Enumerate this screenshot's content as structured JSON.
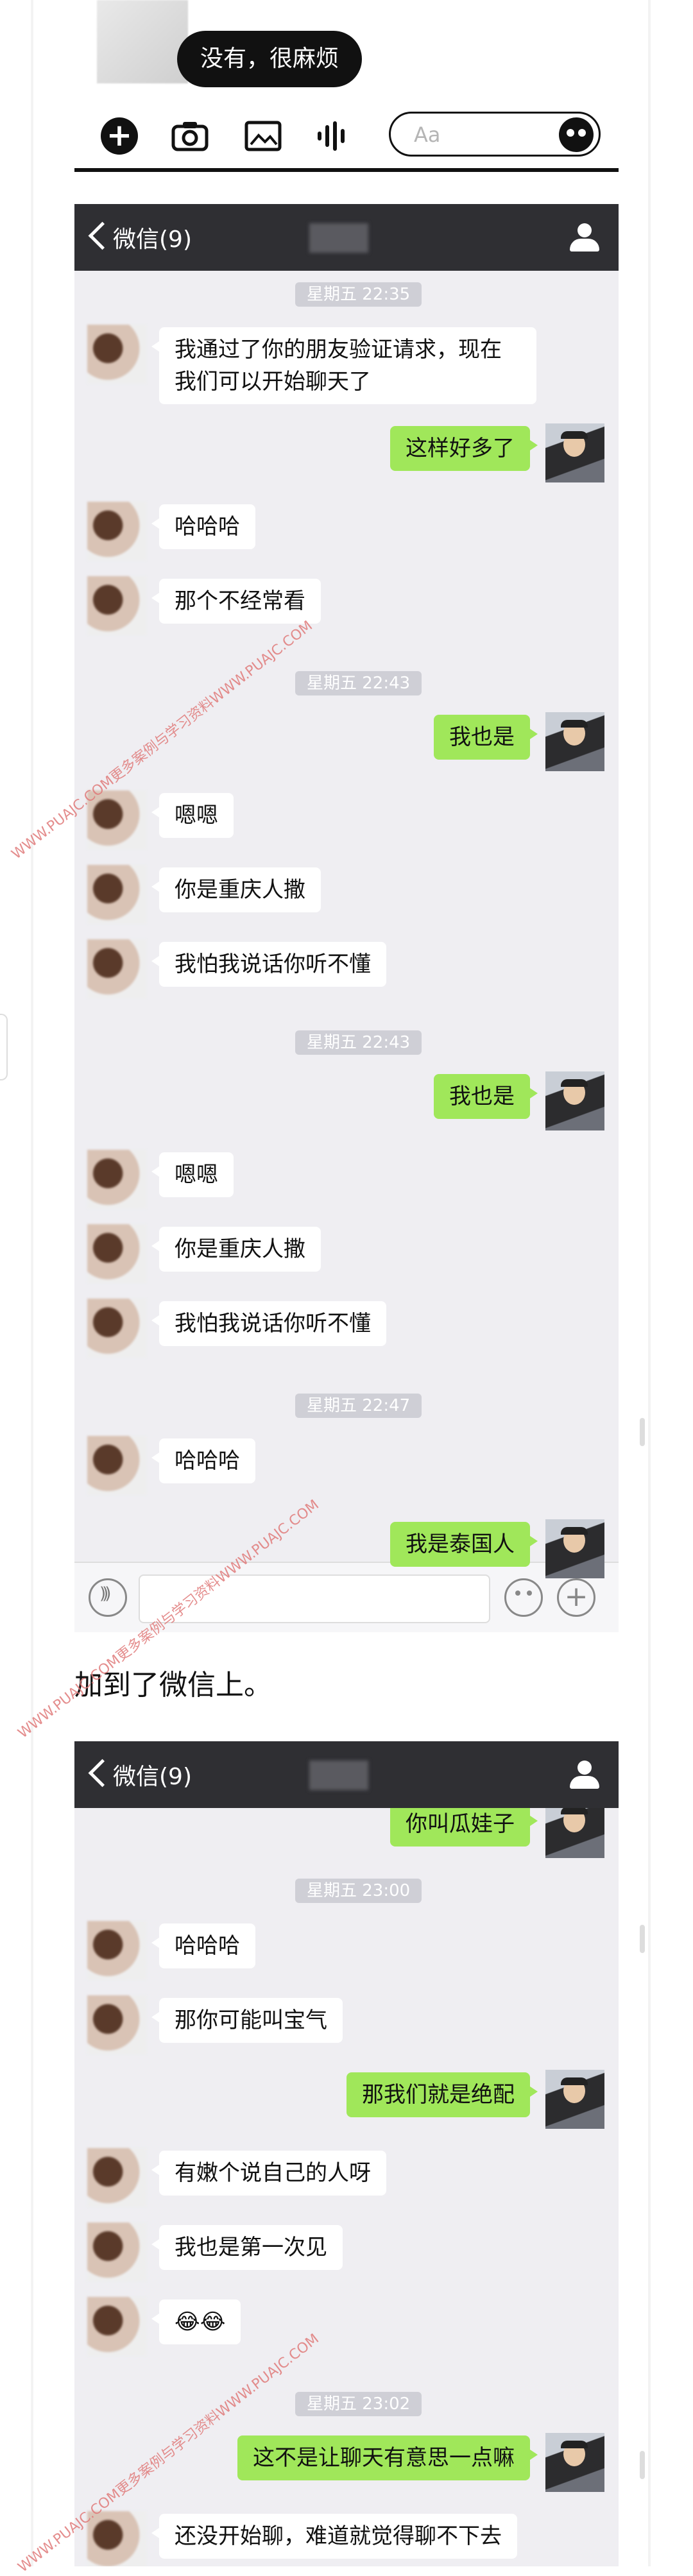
{
  "top_strip": {
    "bubble_text": "没有，很麻烦",
    "input_placeholder": "Aa"
  },
  "panels": [
    {
      "header_title": "微信(9)",
      "items": [
        {
          "kind": "ts",
          "text": "星期五 22:35"
        },
        {
          "kind": "in",
          "text": "我通过了你的朋友验证请求，现在我们可以开始聊天了",
          "multi": true
        },
        {
          "kind": "out",
          "text": "这样好多了"
        },
        {
          "kind": "in",
          "text": "哈哈哈"
        },
        {
          "kind": "in",
          "text": "那个不经常看"
        },
        {
          "kind": "ts",
          "text": "星期五 22:43"
        },
        {
          "kind": "out",
          "text": "我也是"
        },
        {
          "kind": "in",
          "text": "嗯嗯"
        },
        {
          "kind": "in",
          "text": "你是重庆人撒"
        },
        {
          "kind": "in",
          "text": "我怕我说话你听不懂"
        },
        {
          "kind": "ts",
          "text": "星期五 22:43"
        },
        {
          "kind": "out",
          "text": "我也是"
        },
        {
          "kind": "in",
          "text": "嗯嗯"
        },
        {
          "kind": "in",
          "text": "你是重庆人撒"
        },
        {
          "kind": "in",
          "text": "我怕我说话你听不懂"
        },
        {
          "kind": "ts",
          "text": "星期五 22:47"
        },
        {
          "kind": "in",
          "text": "哈哈哈"
        },
        {
          "kind": "out",
          "text": "我是泰国人"
        }
      ]
    },
    {
      "header_title": "微信(9)",
      "items": [
        {
          "kind": "out",
          "text": "你叫瓜娃子"
        },
        {
          "kind": "ts",
          "text": "星期五 23:00"
        },
        {
          "kind": "in",
          "text": "哈哈哈"
        },
        {
          "kind": "in",
          "text": "那你可能叫宝气"
        },
        {
          "kind": "out",
          "text": "那我们就是绝配"
        },
        {
          "kind": "in",
          "text": "有嫩个说自己的人呀"
        },
        {
          "kind": "in",
          "text": "我也是第一次见"
        },
        {
          "kind": "in",
          "text": "😂😂"
        },
        {
          "kind": "ts",
          "text": "星期五 23:02"
        },
        {
          "kind": "out",
          "text": "这不是让聊天有意思一点嘛"
        },
        {
          "kind": "in",
          "text": "还没开始聊，难道就觉得聊不下去"
        }
      ]
    }
  ],
  "middle_text": "加到了微信上。",
  "watermark_text": "WWW.PUAJC.COM更多案例与学习资料WWW.PUAJC.COM",
  "colors": {
    "header_bg": "#2f2f33",
    "chat_bg": "#efeef2",
    "out_bubble": "#a0e75a",
    "in_bubble": "#ffffff",
    "timestamp_bg": "#cfcfd6",
    "watermark": "#e07a7a"
  }
}
